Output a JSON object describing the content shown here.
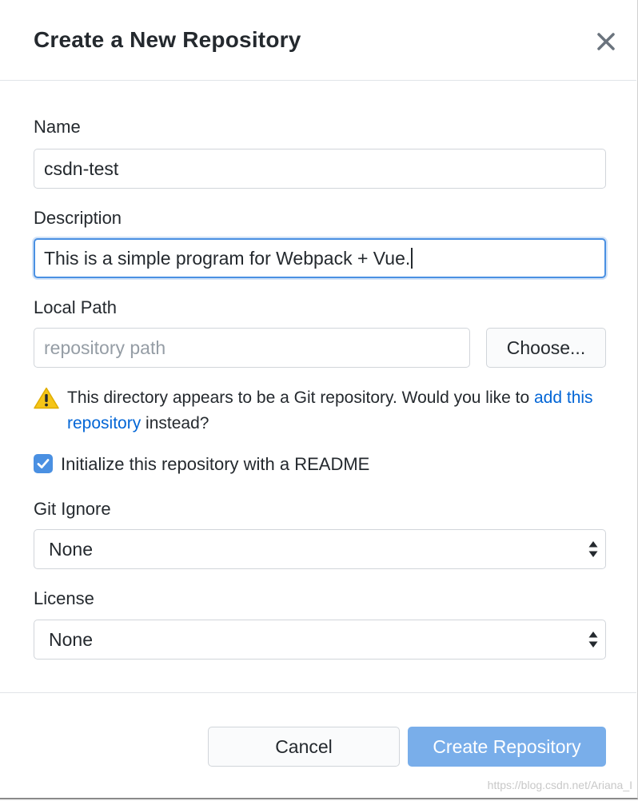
{
  "dialog": {
    "title": "Create a New Repository",
    "close_icon": "close-icon"
  },
  "name": {
    "label": "Name",
    "value": "csdn-test"
  },
  "description": {
    "label": "Description",
    "value": "This is a simple program for Webpack + Vue."
  },
  "local_path": {
    "label": "Local Path",
    "placeholder": "repository path",
    "choose_label": "Choose..."
  },
  "warning": {
    "icon": "warning-icon",
    "text_before": "This directory appears to be a Git repository. Would you like to",
    "link_text": "add this repository",
    "text_after": "instead?"
  },
  "readme": {
    "checked": true,
    "label": "Initialize this repository with a README"
  },
  "git_ignore": {
    "label": "Git Ignore",
    "selected": "None"
  },
  "license": {
    "label": "License",
    "selected": "None"
  },
  "footer": {
    "cancel_label": "Cancel",
    "create_label": "Create Repository"
  },
  "watermark": "https://blog.csdn.net/Ariana_I",
  "colors": {
    "accent": "#4a90e2",
    "link": "#0366d6",
    "primary_disabled": "#79aeea",
    "warning": "#f5c518"
  }
}
